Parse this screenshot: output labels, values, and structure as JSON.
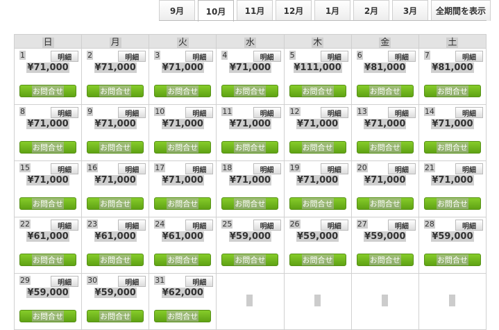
{
  "tabs": [
    {
      "label": "9月",
      "active": false
    },
    {
      "label": "10月",
      "active": true
    },
    {
      "label": "11月",
      "active": false
    },
    {
      "label": "12月",
      "active": false
    },
    {
      "label": "1月",
      "active": false
    },
    {
      "label": "2月",
      "active": false
    },
    {
      "label": "3月",
      "active": false
    },
    {
      "label": "全期間を表示",
      "active": false
    }
  ],
  "weekdays": [
    "日",
    "月",
    "火",
    "水",
    "木",
    "金",
    "土"
  ],
  "detail_label": "明細",
  "inquire_label": "お問合せ",
  "days": [
    {
      "day": "1",
      "price": "¥71,000"
    },
    {
      "day": "2",
      "price": "¥71,000"
    },
    {
      "day": "3",
      "price": "¥71,000"
    },
    {
      "day": "4",
      "price": "¥71,000"
    },
    {
      "day": "5",
      "price": "¥111,000"
    },
    {
      "day": "6",
      "price": "¥81,000"
    },
    {
      "day": "7",
      "price": "¥81,000"
    },
    {
      "day": "8",
      "price": "¥71,000"
    },
    {
      "day": "9",
      "price": "¥71,000"
    },
    {
      "day": "10",
      "price": "¥71,000"
    },
    {
      "day": "11",
      "price": "¥71,000"
    },
    {
      "day": "12",
      "price": "¥71,000"
    },
    {
      "day": "13",
      "price": "¥71,000"
    },
    {
      "day": "14",
      "price": "¥71,000"
    },
    {
      "day": "15",
      "price": "¥71,000"
    },
    {
      "day": "16",
      "price": "¥71,000"
    },
    {
      "day": "17",
      "price": "¥71,000"
    },
    {
      "day": "18",
      "price": "¥71,000"
    },
    {
      "day": "19",
      "price": "¥71,000"
    },
    {
      "day": "20",
      "price": "¥71,000"
    },
    {
      "day": "21",
      "price": "¥71,000"
    },
    {
      "day": "22",
      "price": "¥61,000"
    },
    {
      "day": "23",
      "price": "¥61,000"
    },
    {
      "day": "24",
      "price": "¥61,000"
    },
    {
      "day": "25",
      "price": "¥59,000"
    },
    {
      "day": "26",
      "price": "¥59,000"
    },
    {
      "day": "27",
      "price": "¥59,000"
    },
    {
      "day": "28",
      "price": "¥59,000"
    },
    {
      "day": "29",
      "price": "¥59,000"
    },
    {
      "day": "30",
      "price": "¥59,000"
    },
    {
      "day": "31",
      "price": "¥62,000"
    }
  ],
  "colors": {
    "inquire_button": "#6cb31d",
    "header_bg": "#e3e3e3"
  }
}
